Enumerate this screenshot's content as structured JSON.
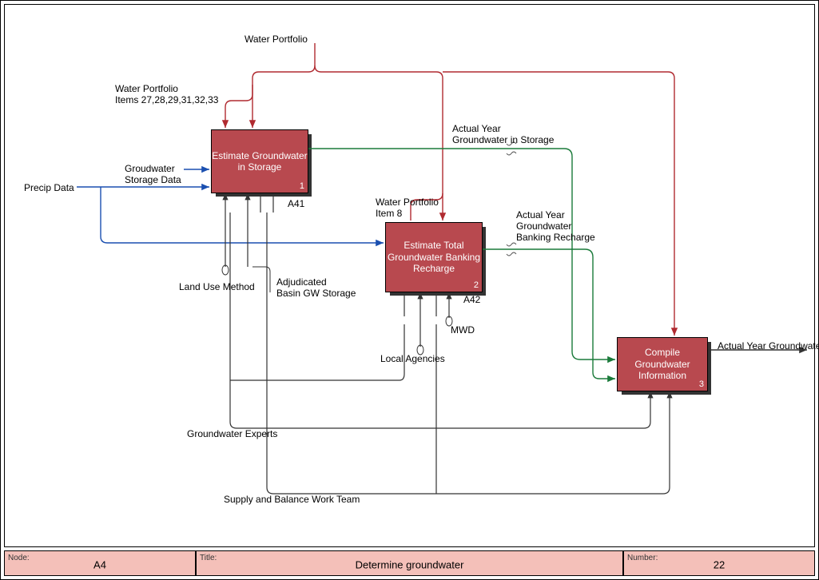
{
  "footer": {
    "node_label": "Node:",
    "node_value": "A4",
    "title_label": "Title:",
    "title_value": "Determine groundwater",
    "number_label": "Number:",
    "number_value": "22"
  },
  "boxes": {
    "a41": {
      "title": "Estimate Groundwater in Storage",
      "num": "1",
      "ext": "A41"
    },
    "a42": {
      "title": "Estimate Total Groundwater Banking Recharge",
      "num": "2",
      "ext": "A42"
    },
    "a43": {
      "title": "Compile Groundwater Information",
      "num": "3"
    }
  },
  "labels": {
    "water_portfolio_top": "Water Portfolio",
    "water_portfolio_items": "Water Portfolio\nItems 27,28,29,31,32,33",
    "water_portfolio_item8": "Water Portfolio\nItem 8",
    "actual_year_storage": "Actual Year\nGroundwater in Storage",
    "actual_year_banking": "Actual Year\nGroundwater\nBanking Recharge",
    "actual_year_gw": "Actual Year Groundwater",
    "precip_data": "Precip Data",
    "groundwater_storage_data": "Groudwater\nStorage Data",
    "land_use_method": "Land Use Method",
    "adjudicated": "Adjudicated\nBasin GW Storage",
    "mwd": "MWD",
    "local_agencies": "Local Agencies",
    "groundwater_experts": "Groundwater Experts",
    "supply_team": "Supply and Balance Work Team"
  },
  "colors": {
    "red": "#b02a30",
    "green": "#1a7a3a",
    "blue": "#1a4fb0",
    "black": "#333"
  }
}
